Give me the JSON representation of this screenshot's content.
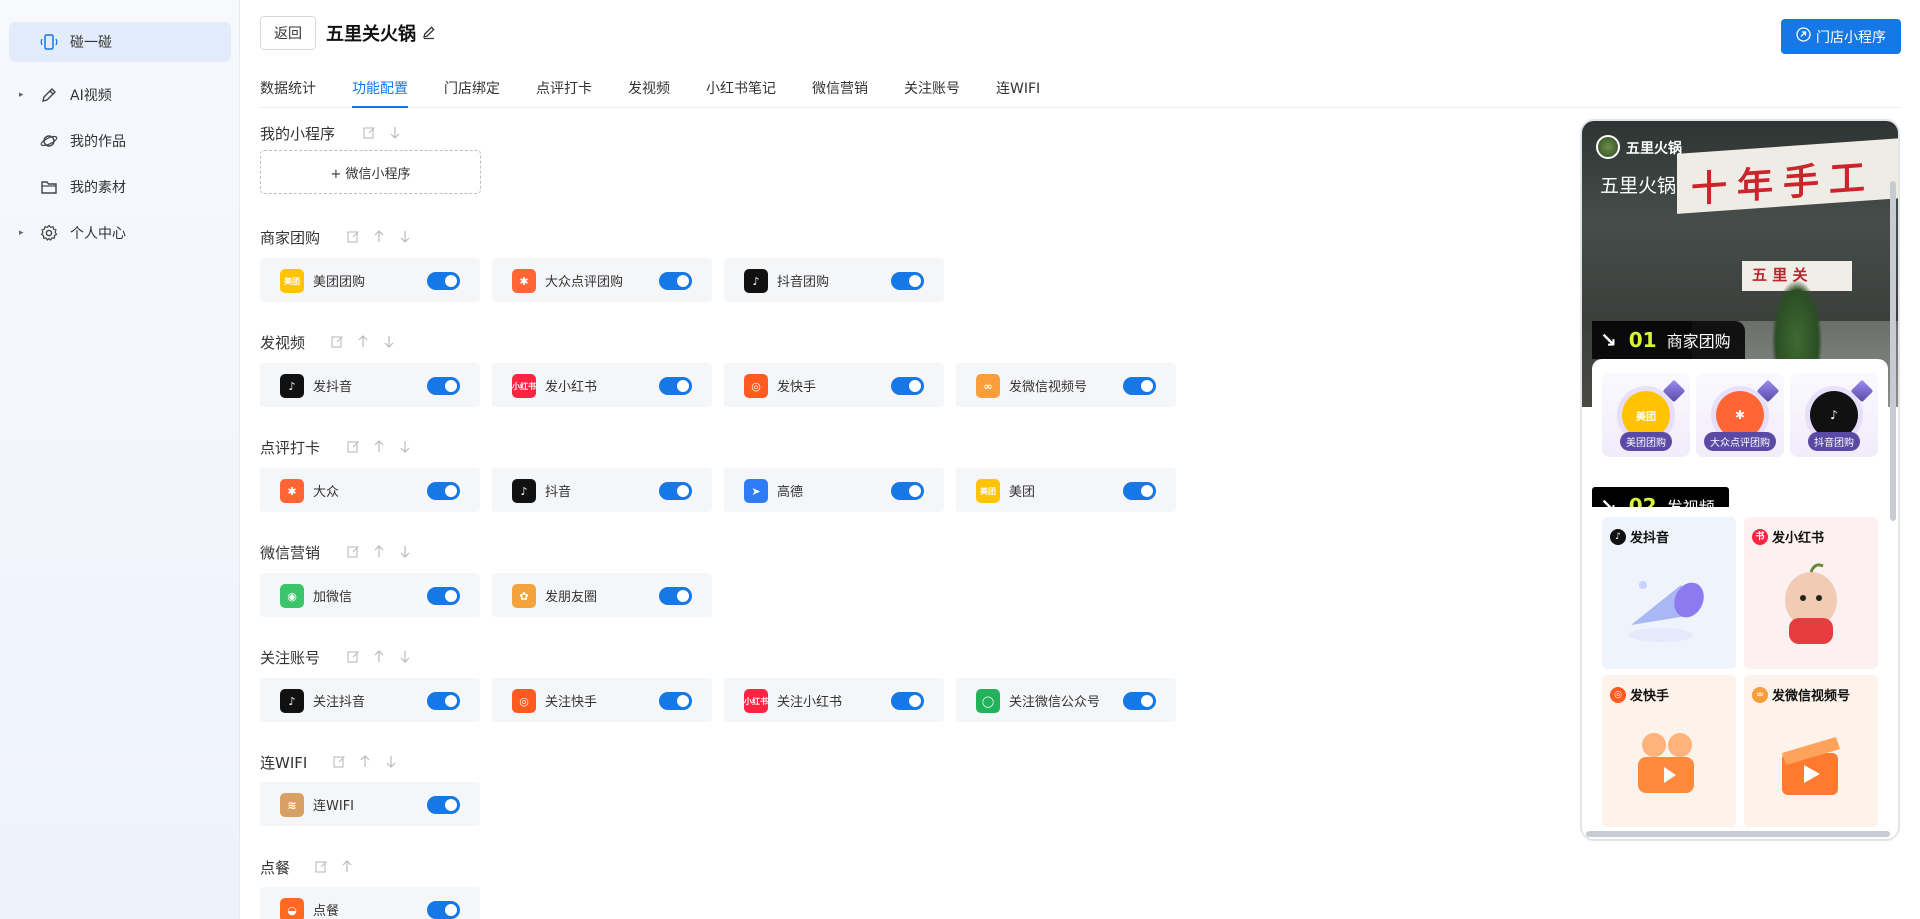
{
  "sidebar": {
    "items": [
      {
        "label": "碰一碰",
        "icon": "phone-tap-icon",
        "active": true,
        "caret": false
      },
      {
        "label": "AI视频",
        "icon": "pen-icon",
        "active": false,
        "caret": true
      },
      {
        "label": "我的作品",
        "icon": "planet-icon",
        "active": false,
        "caret": false
      },
      {
        "label": "我的素材",
        "icon": "folder-icon",
        "active": false,
        "caret": false
      },
      {
        "label": "个人中心",
        "icon": "gear-icon",
        "active": false,
        "caret": true
      }
    ]
  },
  "header": {
    "back_label": "返回",
    "store_name": "五里关火锅",
    "mini_program_button": "门店小程序"
  },
  "tabs": [
    {
      "label": "数据统计",
      "active": false
    },
    {
      "label": "功能配置",
      "active": true
    },
    {
      "label": "门店绑定",
      "active": false
    },
    {
      "label": "点评打卡",
      "active": false
    },
    {
      "label": "发视频",
      "active": false
    },
    {
      "label": "小红书笔记",
      "active": false
    },
    {
      "label": "微信营销",
      "active": false
    },
    {
      "label": "关注账号",
      "active": false
    },
    {
      "label": "连WIFI",
      "active": false
    }
  ],
  "sections": {
    "mini_program": {
      "title": "我的小程序",
      "add_label": "+ 微信小程序"
    },
    "group_buy": {
      "title": "商家团购",
      "items": [
        {
          "label": "美团团购",
          "icon": "meituan-icon",
          "color": "#ffc300",
          "glyph": "美团",
          "enabled": true
        },
        {
          "label": "大众点评团购",
          "icon": "dianping-icon",
          "color": "#ff6633",
          "glyph": "✱",
          "enabled": true
        },
        {
          "label": "抖音团购",
          "icon": "douyin-icon",
          "color": "#111111",
          "glyph": "♪",
          "enabled": true
        }
      ]
    },
    "video": {
      "title": "发视频",
      "items": [
        {
          "label": "发抖音",
          "icon": "douyin-icon",
          "color": "#111111",
          "glyph": "♪",
          "enabled": true
        },
        {
          "label": "发小红书",
          "icon": "xiaohongshu-icon",
          "color": "#ff2442",
          "glyph": "小红书",
          "enabled": true
        },
        {
          "label": "发快手",
          "icon": "kuaishou-icon",
          "color": "#ff5a1f",
          "glyph": "◎",
          "enabled": true
        },
        {
          "label": "发微信视频号",
          "icon": "wechat-channels-icon",
          "color": "#fa9d3b",
          "glyph": "∞",
          "enabled": true
        }
      ]
    },
    "review": {
      "title": "点评打卡",
      "items": [
        {
          "label": "大众",
          "icon": "dianping-icon",
          "color": "#ff6633",
          "glyph": "✱",
          "enabled": true
        },
        {
          "label": "抖音",
          "icon": "douyin-icon",
          "color": "#111111",
          "glyph": "♪",
          "enabled": true
        },
        {
          "label": "高德",
          "icon": "amap-icon",
          "color": "#2f7df6",
          "glyph": "➤",
          "enabled": true
        },
        {
          "label": "美团",
          "icon": "meituan-icon",
          "color": "#ffc300",
          "glyph": "美团",
          "enabled": true
        }
      ]
    },
    "wechat": {
      "title": "微信营销",
      "items": [
        {
          "label": "加微信",
          "icon": "wechat-icon",
          "color": "#3cc46a",
          "glyph": "◉",
          "enabled": true
        },
        {
          "label": "发朋友圈",
          "icon": "moments-icon",
          "color": "#f4a23b",
          "glyph": "✿",
          "enabled": true
        }
      ]
    },
    "follow": {
      "title": "关注账号",
      "items": [
        {
          "label": "关注抖音",
          "icon": "douyin-icon",
          "color": "#111111",
          "glyph": "♪",
          "enabled": true
        },
        {
          "label": "关注快手",
          "icon": "kuaishou-icon",
          "color": "#ff5a1f",
          "glyph": "◎",
          "enabled": true
        },
        {
          "label": "关注小红书",
          "icon": "xiaohongshu-icon",
          "color": "#ff2442",
          "glyph": "小红书",
          "enabled": true
        },
        {
          "label": "关注微信公众号",
          "icon": "wechat-official-icon",
          "color": "#21b25a",
          "glyph": "◯",
          "enabled": true
        }
      ]
    },
    "wifi": {
      "title": "连WIFI",
      "items": [
        {
          "label": "连WIFI",
          "icon": "wifi-icon",
          "color": "#d9a066",
          "glyph": "≋",
          "enabled": true
        }
      ]
    },
    "order": {
      "title": "点餐",
      "items": [
        {
          "label": "点餐",
          "icon": "dish-icon",
          "color": "#ff6a1f",
          "glyph": "◒",
          "enabled": true
        }
      ]
    }
  },
  "preview": {
    "brand": "五里火锅",
    "store": "五里火锅",
    "photo_banner_text": "十年手工",
    "photo_shelf_text": "五 里 关",
    "step1": {
      "num": "01",
      "title": "商家团购"
    },
    "step1_items": [
      {
        "label": "美团团购",
        "color": "#ffc300",
        "glyph": "美团"
      },
      {
        "label": "大众点评团购",
        "color": "#ff6633",
        "glyph": "✱"
      },
      {
        "label": "抖音团购",
        "color": "#111111",
        "glyph": "♪"
      }
    ],
    "step2": {
      "num": "02",
      "title": "发视频"
    },
    "step2_items": [
      {
        "label": "发抖音",
        "color": "#111111",
        "glyph": "♪",
        "bg": "#eef3fc"
      },
      {
        "label": "发小红书",
        "color": "#ff2442",
        "glyph": "书",
        "bg": "#fdf0f1"
      },
      {
        "label": "发快手",
        "color": "#ff5a1f",
        "glyph": "◎",
        "bg": "#fdf3ea"
      },
      {
        "label": "发微信视频号",
        "color": "#fa9d3b",
        "glyph": "∞",
        "bg": "#fdf3ea"
      }
    ]
  },
  "accent": "#1677e6"
}
